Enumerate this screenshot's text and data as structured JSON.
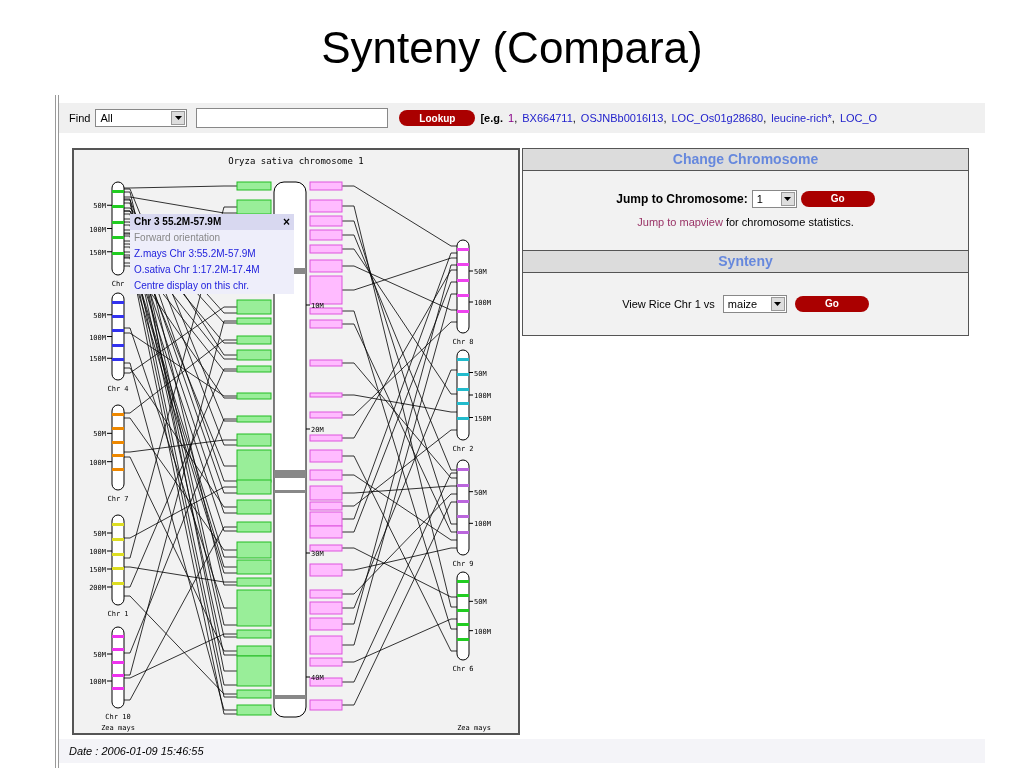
{
  "slide_title": "Synteny (Compara)",
  "find": {
    "label": "Find",
    "scope": "All",
    "lookup_button": "Lookup",
    "examples_prefix": "[e.g.",
    "separator": ",",
    "examples": [
      {
        "text": "1",
        "visited": true
      },
      {
        "text": "BX664711",
        "visited": false
      },
      {
        "text": "OSJNBb0016I13",
        "visited": false
      },
      {
        "text": "LOC_Os01g28680",
        "visited": false
      },
      {
        "text": "leucine-rich*",
        "visited": false
      },
      {
        "text": "LOC_O",
        "visited": false
      }
    ]
  },
  "diagram": {
    "title": "Oryza sativa chromosome 1",
    "species_left": "Zea mays",
    "species_right": "Zea mays",
    "center_ticks": [
      "10M",
      "20M",
      "30M",
      "40M"
    ],
    "left_chromosomes": [
      {
        "label": "Chr",
        "color": "#22cc22",
        "ticks": [
          "50M",
          "100M",
          "150M"
        ]
      },
      {
        "label": "Chr 4",
        "color": "#3333ee",
        "ticks": [
          "50M",
          "100M",
          "150M"
        ]
      },
      {
        "label": "Chr 7",
        "color": "#ee8800",
        "ticks": [
          "50M",
          "100M"
        ]
      },
      {
        "label": "Chr 1",
        "color": "#dddd22",
        "ticks": [
          "50M",
          "100M",
          "150M",
          "200M"
        ]
      },
      {
        "label": "Chr 10",
        "color": "#ee33ee",
        "ticks": [
          "50M",
          "100M"
        ]
      }
    ],
    "right_chromosomes": [
      {
        "label": "Chr 8",
        "color": "#ee44ee",
        "ticks": [
          "50M",
          "100M"
        ]
      },
      {
        "label": "Chr 2",
        "color": "#22bbcc",
        "ticks": [
          "50M",
          "100M",
          "150M"
        ]
      },
      {
        "label": "Chr 9",
        "color": "#bb66dd",
        "ticks": [
          "50M",
          "100M"
        ]
      },
      {
        "label": "Chr 6",
        "color": "#22cc22",
        "ticks": [
          "50M",
          "100M"
        ]
      }
    ],
    "tooltip": {
      "title": "Chr 3 55.2M-57.9M",
      "close": "×",
      "note": "Forward orientation",
      "links": [
        "Z.mays Chr 3:55.2M-57.9M",
        "O.sativa Chr 1:17.2M-17.4M",
        "Centre display on this chr."
      ]
    }
  },
  "change_chromosome": {
    "heading": "Change Chromosome",
    "label": "Jump to Chromosome:",
    "value": "1",
    "button": "Go",
    "link": "Jump to mapview",
    "link_rest": " for chromosome statistics."
  },
  "synteny": {
    "heading": "Synteny",
    "label": "View Rice Chr 1 vs",
    "value": "maize",
    "button": "Go"
  },
  "date": "Date : 2006-01-09 15:46:55"
}
